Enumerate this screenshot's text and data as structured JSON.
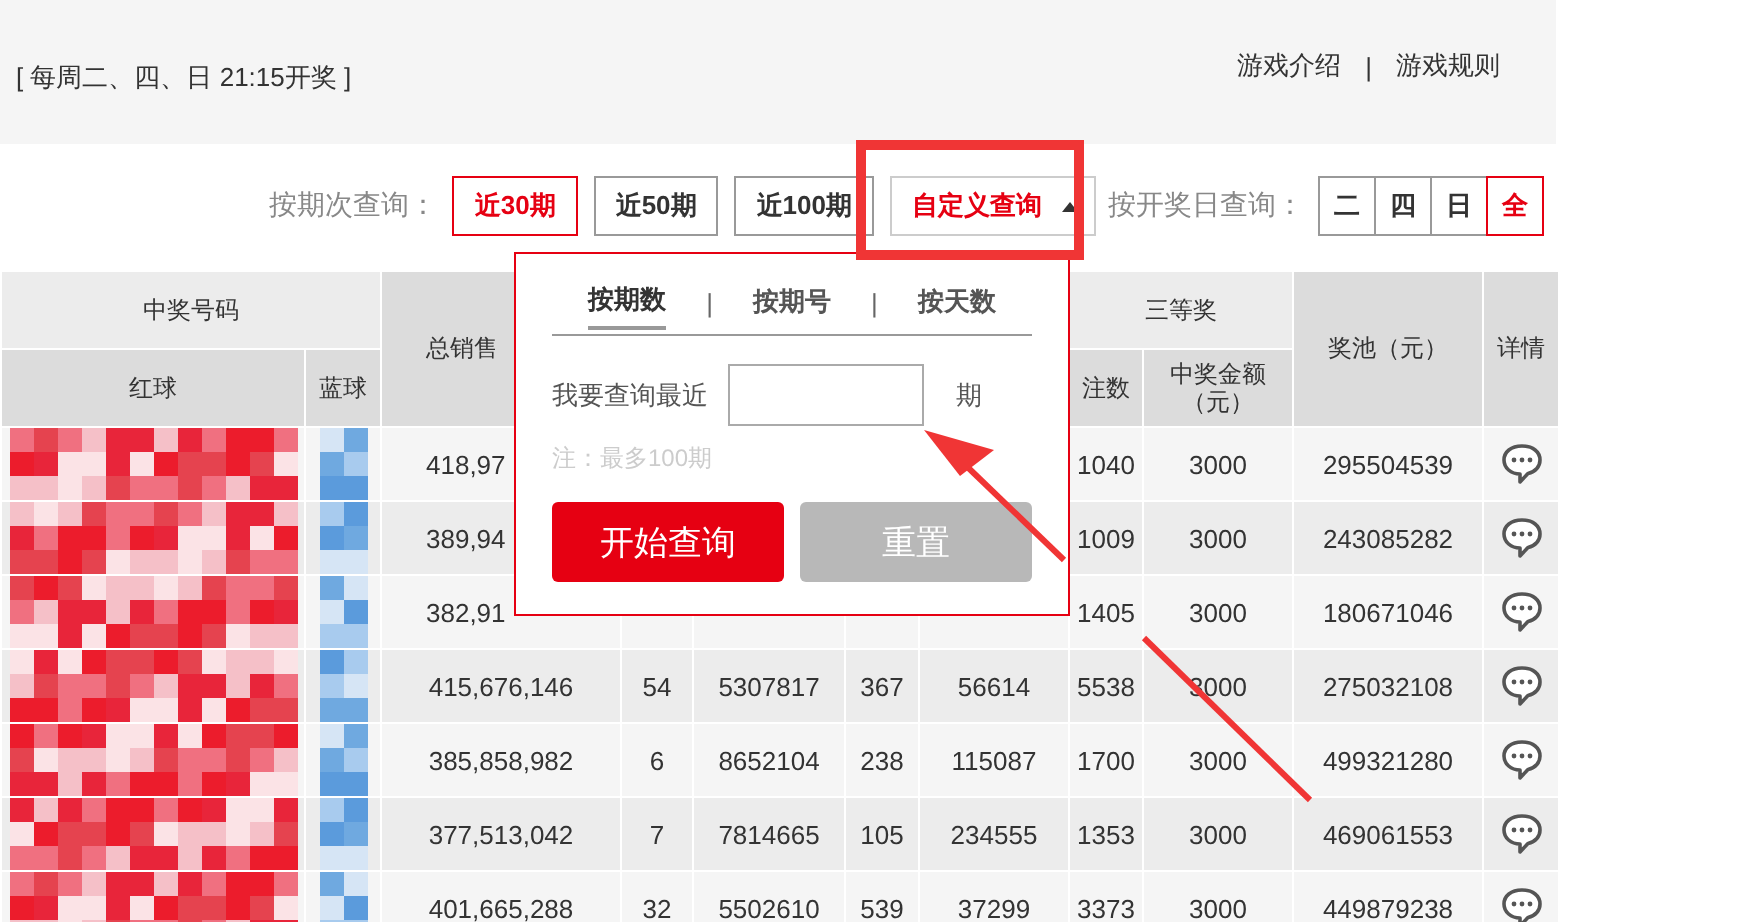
{
  "header": {
    "schedule": "[ 每周二、四、日 21:15开奖 ]",
    "links": [
      "游戏介绍",
      "游戏规则"
    ],
    "link_separator": "|"
  },
  "period_filter": {
    "label": "按期次查询：",
    "options": [
      {
        "label": "近30期",
        "selected": true
      },
      {
        "label": "近50期",
        "selected": false
      },
      {
        "label": "近100期",
        "selected": false
      }
    ],
    "custom": {
      "label": "自定义查询",
      "expanded": true
    }
  },
  "day_filter": {
    "label": "按开奖日查询：",
    "options": [
      {
        "label": "二",
        "selected": false
      },
      {
        "label": "四",
        "selected": false
      },
      {
        "label": "日",
        "selected": false
      },
      {
        "label": "全",
        "selected": true
      }
    ]
  },
  "custom_query_popup": {
    "tabs": [
      {
        "label": "按期数",
        "selected": true
      },
      {
        "label": "按期号",
        "selected": false
      },
      {
        "label": "按天数",
        "selected": false
      }
    ],
    "tab_separator": "|",
    "prompt": "我要查询最近",
    "unit": "期",
    "note": "注：最多100期",
    "buttons": [
      {
        "label": "开始查询",
        "disabled": false
      },
      {
        "label": "重置",
        "disabled": true
      }
    ]
  },
  "table": {
    "winning_numbers": "中奖号码",
    "red_ball": "红球",
    "blue_ball": "蓝球",
    "total_sales": "总销售",
    "third_prize": "三等奖",
    "third_count": "注数",
    "third_amount": "中奖金额（元）",
    "jackpot": "奖池（元）",
    "details": "详情",
    "rows": [
      {
        "cells": [
          "418,97",
          null,
          null,
          null,
          null,
          "1040",
          "3000",
          "295504539"
        ]
      },
      {
        "cells": [
          "389,94",
          null,
          null,
          null,
          null,
          "1009",
          "3000",
          "243085282"
        ]
      },
      {
        "cells": [
          "382,91",
          null,
          null,
          null,
          null,
          "1405",
          "3000",
          "180671046"
        ]
      },
      {
        "cells": [
          "415,676,146",
          "54",
          "5307817",
          "367",
          "56614",
          "5538",
          "3000",
          "275032108"
        ]
      },
      {
        "cells": [
          "385,858,982",
          "6",
          "8652104",
          "238",
          "115087",
          "1700",
          "3000",
          "499321280"
        ]
      },
      {
        "cells": [
          "377,513,042",
          "7",
          "7814665",
          "105",
          "234555",
          "1353",
          "3000",
          "469061553"
        ]
      },
      {
        "cells": [
          "401,665,288",
          "32",
          "5502610",
          "539",
          "37299",
          "3373",
          "3000",
          "449879238"
        ]
      }
    ]
  }
}
